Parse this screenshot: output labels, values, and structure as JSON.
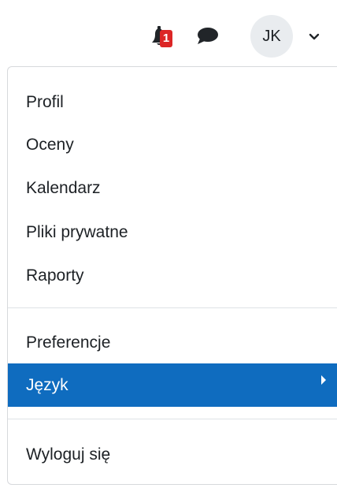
{
  "header": {
    "notification_count": "1",
    "user_initials": "JK"
  },
  "menu": {
    "items": [
      {
        "label": "Profil"
      },
      {
        "label": "Oceny"
      },
      {
        "label": "Kalendarz"
      },
      {
        "label": "Pliki prywatne"
      },
      {
        "label": "Raporty"
      },
      {
        "label": "Preferencje"
      },
      {
        "label": "Język",
        "active": true
      },
      {
        "label": "Wyloguj się"
      }
    ]
  },
  "colors": {
    "active_item_bg": "#0f6cbf",
    "badge_bg": "#dc2626",
    "avatar_bg": "#e9ecef"
  },
  "icons": [
    "bell-icon",
    "chat-icon",
    "chevron-down-icon",
    "caret-right-icon"
  ]
}
